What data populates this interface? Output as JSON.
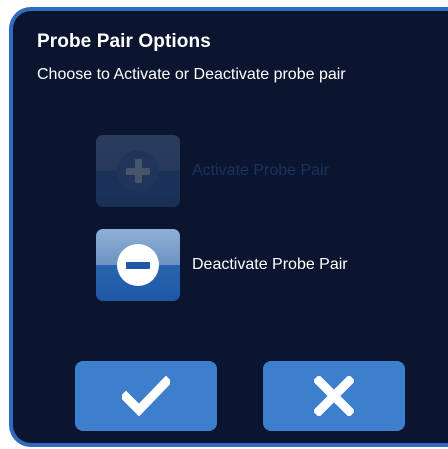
{
  "dialog": {
    "title": "Probe Pair Options",
    "subtitle": "Choose to Activate or Deactivate probe pair"
  },
  "options": [
    {
      "label": "Activate Probe Pair",
      "icon": "plus-circle-icon",
      "enabled": false
    },
    {
      "label": "Deactivate Probe Pair",
      "icon": "minus-circle-icon",
      "enabled": true
    }
  ],
  "buttons": {
    "confirm_icon": "checkmark-icon",
    "cancel_icon": "x-icon"
  },
  "colors": {
    "background": "#0b1530",
    "border": "#2d6bc0",
    "button": "#3d7fcd",
    "disabled_text": "#3a6fc0"
  }
}
